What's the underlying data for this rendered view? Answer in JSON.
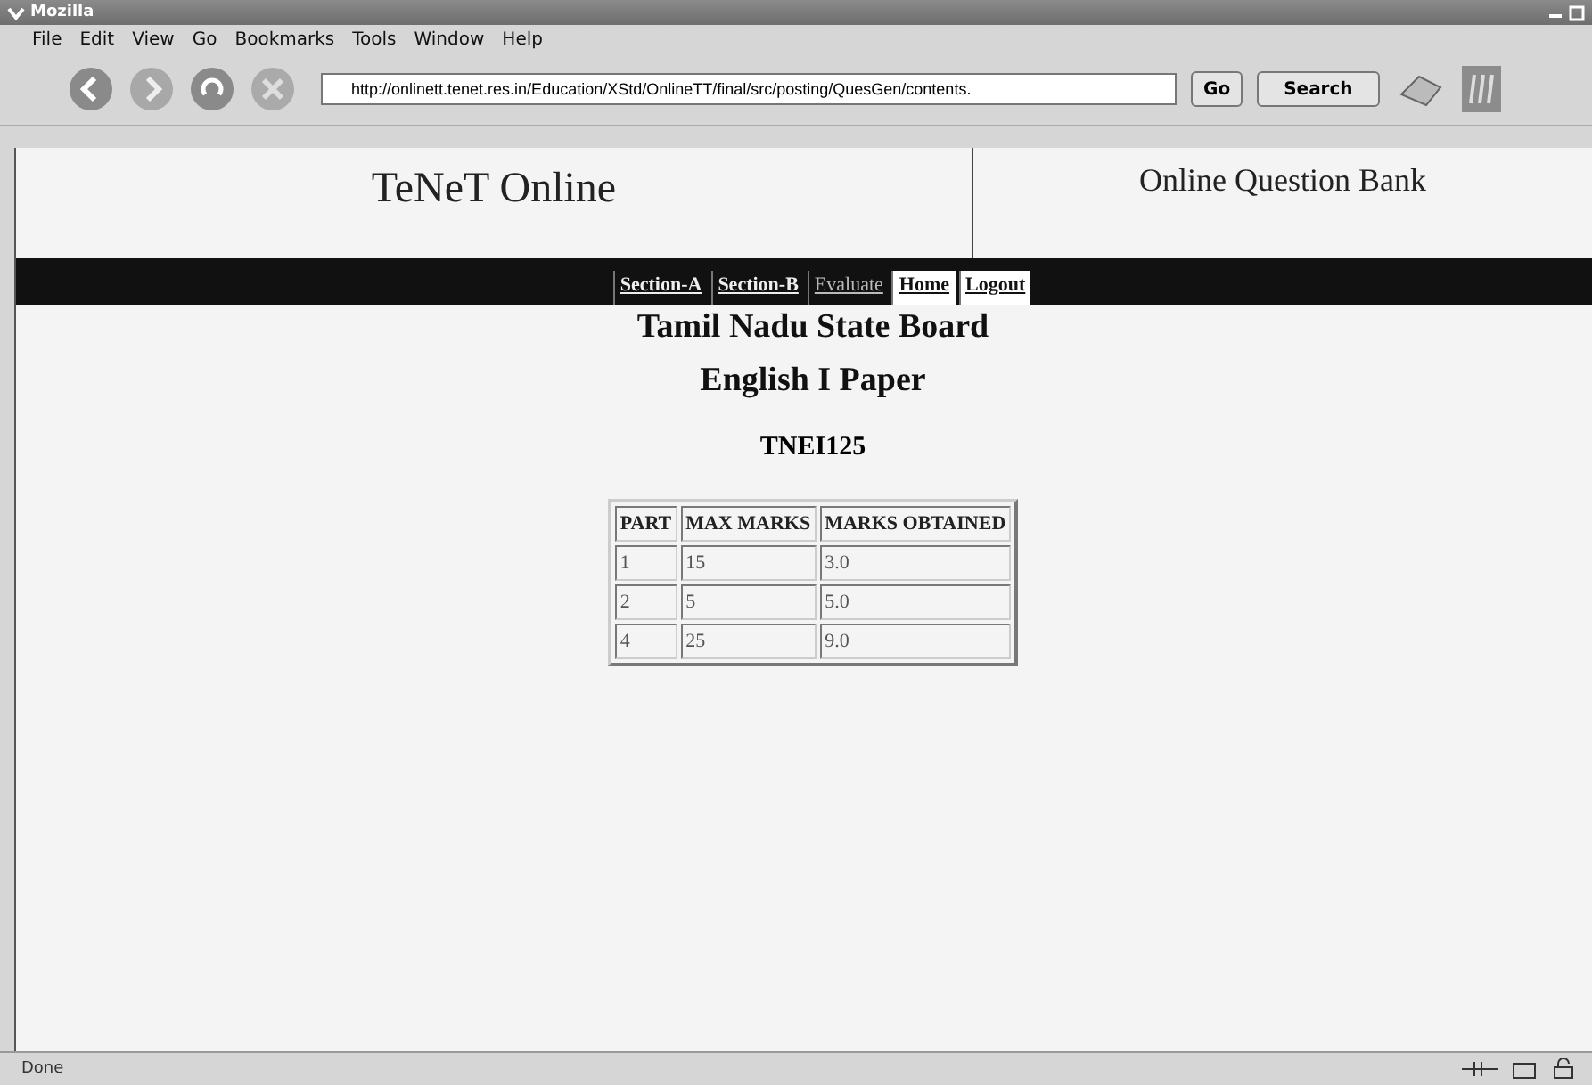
{
  "window": {
    "title": "Mozilla"
  },
  "menu": [
    "File",
    "Edit",
    "View",
    "Go",
    "Bookmarks",
    "Tools",
    "Window",
    "Help"
  ],
  "toolbar": {
    "url": "http://onlinett.tenet.res.in/Education/XStd/OnlineTT/final/src/posting/QuesGen/contents.",
    "go": "Go",
    "search": "Search"
  },
  "header": {
    "site": "TeNeT Online",
    "section": "Online Question Bank"
  },
  "nav": [
    {
      "label": "Section-A",
      "kind": "bold"
    },
    {
      "label": "Section-B",
      "kind": "bold"
    },
    {
      "label": "Evaluate",
      "kind": "plain"
    },
    {
      "label": "Home",
      "kind": "boxed"
    },
    {
      "label": "Logout",
      "kind": "boxed"
    }
  ],
  "headings": [
    "Tamil Nadu State Board",
    "English I Paper"
  ],
  "code": "TNEI125",
  "table": {
    "columns": [
      "PART",
      "MAX MARKS",
      "MARKS OBTAINED"
    ],
    "rows": [
      [
        "1",
        "15",
        "3.0"
      ],
      [
        "2",
        "5",
        "5.0"
      ],
      [
        "4",
        "25",
        "9.0"
      ]
    ]
  },
  "status_bar": "Done"
}
